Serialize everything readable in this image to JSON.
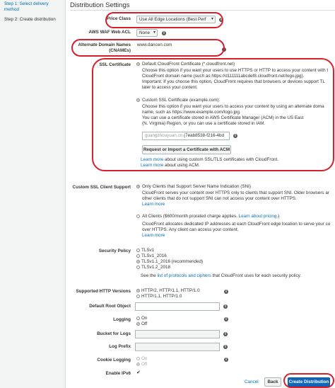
{
  "sidebar": {
    "steps": [
      {
        "label": "Step 1: Select delivery method"
      },
      {
        "label": "Step 2: Create distribution"
      }
    ]
  },
  "page": {
    "title": "Distribution Settings"
  },
  "price_class": {
    "label": "Price Class",
    "value": "Use All Edge Locations (Best Perf"
  },
  "waf": {
    "label": "AWS WAF Web ACL",
    "value": "None"
  },
  "cnames": {
    "label": "Alternate Domain Names (CNAMEs)",
    "value": "www.dancen.com"
  },
  "ssl": {
    "label": "SSL Certificate",
    "default_option": "Default CloudFront Certificate (*.cloudfront.net)",
    "default_desc": [
      "Choose this option if you want your users to use HTTPS or HTTP to access your content with t",
      "CloudFront domain name (such as https://d111111abcdef8.cloudfront.net/logo.jpg).",
      "Important: If you choose this option, CloudFront requires that browsers or devices support TL",
      "later to access your content."
    ],
    "custom_option": "Custom SSL Certificate (example.com):",
    "custom_desc": [
      "Choose this option if you want your users to access your content by using an alternate doma",
      "name, such as https://www.example.com/logo.jpg.",
      "You can use a certificate stored in AWS Certificate Manager (ACM) in the US East",
      "(N. Virginia) Region, or you can use a certificate stored in IAM."
    ],
    "cert_value_blurred": "guangzhouyuan.cn",
    "cert_value": "(7eab8538-f216-4bd",
    "request_button": "Request or Import a Certificate with ACM",
    "learn_more_1": "Learn more",
    "learn_more_1_rest": "about using custom SSL/TLS certificates with CloudFront.",
    "learn_more_2": "Learn more",
    "learn_more_2_rest": "about using ACM."
  },
  "client_support": {
    "label": "Custom SSL Client Support",
    "sni_option": "Only Clients that Support Server Name Indication (SNI)",
    "sni_desc": [
      "CloudFront serves your content over HTTPS only to clients that support SNI. Older browsers ar",
      "other clients that do not support SNI can not access your content over HTTPS."
    ],
    "sni_learn": "Learn more",
    "all_option": "All Clients ($600/month prorated charge applies.",
    "all_learn": "Learn about pricing",
    "all_close": ".)",
    "all_desc": [
      "CloudFront allocates dedicated IP addresses at each CloudFront edge location to serve your co",
      "over HTTPS. Any client can access your content."
    ],
    "all_learn2": "Learn more"
  },
  "security_policy": {
    "label": "Security Policy",
    "options": [
      "TLSv1",
      "TLSv1_2016",
      "TLSv1.1_2016 (recommended)",
      "TLSv1.2_2018"
    ],
    "note_pre": "See the",
    "note_link": "list of protocols and ciphers",
    "note_post": "that CloudFront uses for each security policy."
  },
  "http_versions": {
    "label": "Supported HTTP Versions",
    "options": [
      "HTTP/2, HTTP/1.1, HTTP/1.0",
      "HTTP/1.1, HTTP/1.0"
    ]
  },
  "root_object": {
    "label": "Default Root Object"
  },
  "logging": {
    "label": "Logging",
    "options": [
      "On",
      "Off"
    ]
  },
  "bucket": {
    "label": "Bucket for Logs"
  },
  "log_prefix": {
    "label": "Log Prefix"
  },
  "cookie_logging": {
    "label": "Cookie Logging",
    "options": [
      "On",
      "Off"
    ]
  },
  "ipv6": {
    "label": "Enable IPv6",
    "checkmark": "✔"
  },
  "footer": {
    "cancel": "Cancel",
    "back": "Back",
    "create": "Create Distribution"
  },
  "colors": {
    "accent": "#1166bb",
    "link": "#0073bb",
    "annotation": "#d6202c"
  }
}
